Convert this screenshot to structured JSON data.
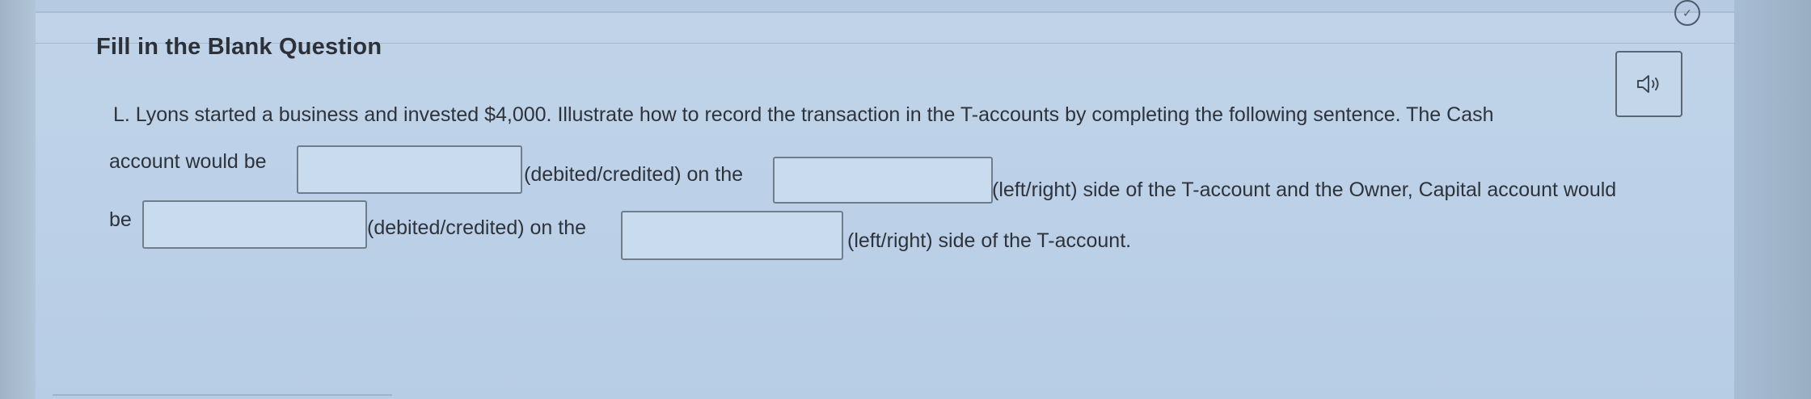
{
  "question": {
    "title": "Fill in the Blank Question",
    "line1": "L. Lyons started a business and invested $4,000. Illustrate how to record the transaction in the T-accounts by completing the following sentence. The Cash",
    "line2_a": "account would be",
    "line2_b": "(debited/credited) on the",
    "line2_c": "(left/right) side of the T-account and the Owner, Capital account would",
    "line3_a": "be",
    "line3_b": "(debited/credited) on the",
    "line3_c": "(left/right) side of the T-account."
  },
  "blanks": {
    "blank1": "",
    "blank2": "",
    "blank3": "",
    "blank4": ""
  },
  "icons": {
    "audio": "speaker-icon",
    "check": "check-circle-icon"
  }
}
